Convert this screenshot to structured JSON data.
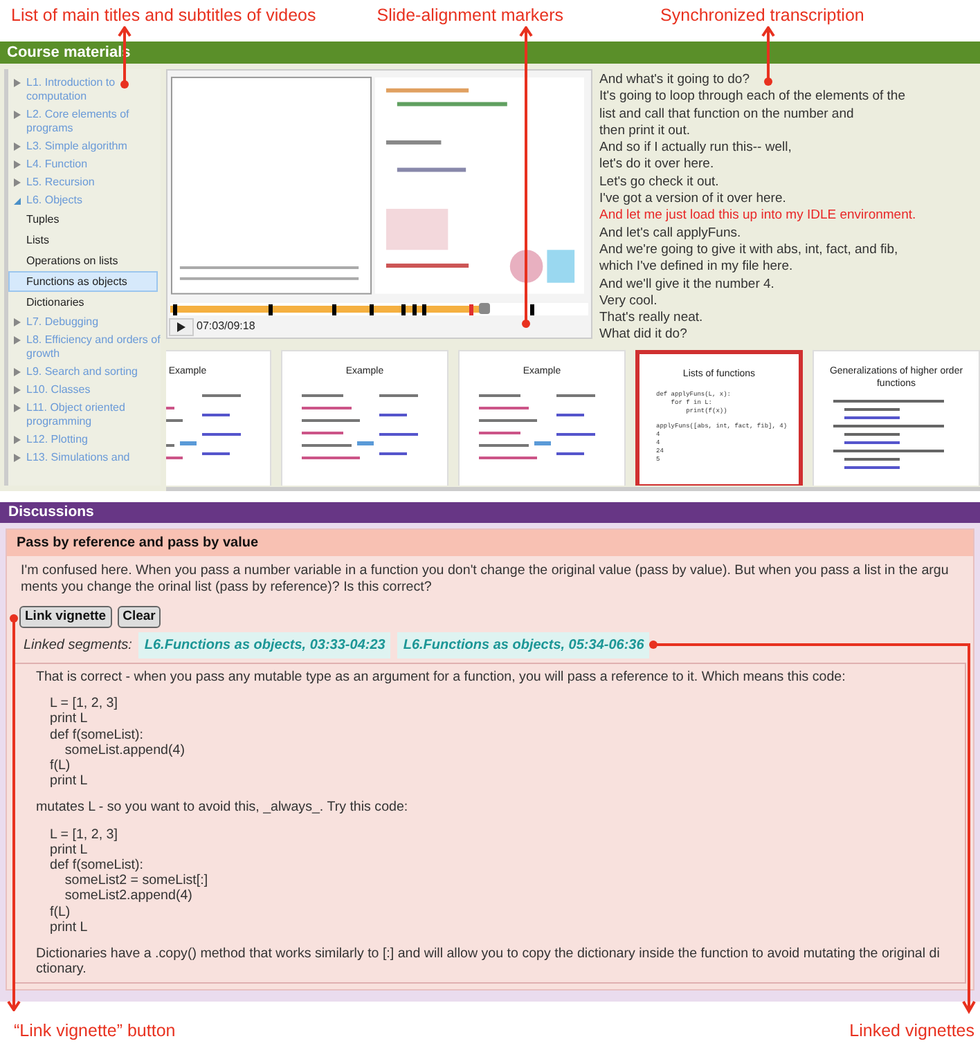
{
  "annotations_top": [
    "List of main titles and subtitles of videos",
    "Slide-alignment markers",
    "Synchronized transcription"
  ],
  "course_materials": {
    "title": "Course materials",
    "sidebar": [
      {
        "label": "L1. Introduction to computation",
        "expanded": false
      },
      {
        "label": "L2. Core elements of programs",
        "expanded": false
      },
      {
        "label": "L3. Simple algorithm",
        "expanded": false
      },
      {
        "label": "L4. Function",
        "expanded": false
      },
      {
        "label": "L5. Recursion",
        "expanded": false
      },
      {
        "label": "L6. Objects",
        "expanded": true,
        "children": [
          {
            "label": "Tuples",
            "selected": false
          },
          {
            "label": "Lists",
            "selected": false
          },
          {
            "label": "Operations on lists",
            "selected": false
          },
          {
            "label": "Functions as objects",
            "selected": true
          },
          {
            "label": "Dictionaries",
            "selected": false
          }
        ]
      },
      {
        "label": "L7. Debugging",
        "expanded": false
      },
      {
        "label": "L8. Efficiency and orders of growth",
        "expanded": false
      },
      {
        "label": "L9. Search and sorting",
        "expanded": false
      },
      {
        "label": "L10. Classes",
        "expanded": false
      },
      {
        "label": "L11. Object oriented programming",
        "expanded": false
      },
      {
        "label": "L12. Plotting",
        "expanded": false
      },
      {
        "label": "L13. Simulations and",
        "expanded": false
      }
    ],
    "player": {
      "level": 0.75,
      "time": "07:03/09:18",
      "markers": [
        {
          "level": 0.008,
          "selected": false
        },
        {
          "level": 0.236,
          "selected": false
        },
        {
          "level": 0.387,
          "selected": false
        },
        {
          "level": 0.478,
          "selected": false
        },
        {
          "level": 0.552,
          "selected": false
        },
        {
          "level": 0.58,
          "selected": false
        },
        {
          "level": 0.604,
          "selected": false
        },
        {
          "level": 0.716,
          "selected": true
        },
        {
          "level": 0.86,
          "selected": false
        }
      ]
    },
    "transcript": [
      {
        "text": "And what's it going to do?",
        "selected": false
      },
      {
        "text": "It's going to loop through each of the elements of the",
        "selected": false
      },
      {
        "text": "list and call that function on the number and",
        "selected": false
      },
      {
        "text": "then print it out.",
        "selected": false
      },
      {
        "text": "And so if I actually run this-- well,",
        "selected": false
      },
      {
        "text": "let's do it over here.",
        "selected": false
      },
      {
        "text": "Let's go check it out.",
        "selected": false
      },
      {
        "text": "I've got a version of it over here.",
        "selected": false
      },
      {
        "text": "And let me just load this up into my IDLE environment.",
        "selected": true
      },
      {
        "text": "And let's call applyFuns.",
        "selected": false
      },
      {
        "text": "And we're going to give it with abs, int, fact, and fib,",
        "selected": false
      },
      {
        "text": "which I've defined in my file here.",
        "selected": false
      },
      {
        "text": "And we'll give it the number 4.",
        "selected": false
      },
      {
        "text": "Very cool.",
        "selected": false
      },
      {
        "text": "That's really neat.",
        "selected": false
      },
      {
        "text": "What did it do?",
        "selected": false
      }
    ],
    "slides": [
      {
        "title": "Example",
        "kind": "code",
        "selected": false
      },
      {
        "title": "Example",
        "kind": "code",
        "selected": false
      },
      {
        "title": "Example",
        "kind": "code",
        "selected": false
      },
      {
        "title": "Lists of functions",
        "kind": "listing",
        "selected": true,
        "lines": [
          "def applyFuns(L, x):",
          "    for f in L:",
          "        print(f(x))"
        ],
        "call_lines": [
          "applyFuns([abs, int, fact, fib], 4)",
          "4",
          "4",
          "24",
          "5"
        ]
      },
      {
        "title": "Generalizations of higher order functions",
        "kind": "bullets",
        "selected": false
      }
    ]
  },
  "discussions": {
    "title": "Discussions",
    "thread": {
      "title": "Pass by reference and pass by value",
      "question": "I'm confused here. When you pass a number variable in a function you don't change the original value (pass by value). But when you pass a list in the arguments you change the orinal list (pass by reference)? Is this correct?",
      "buttons": [
        "Link vignette",
        "Clear"
      ],
      "linked_label": "Linked segments:",
      "linked_segments": [
        "L6.Functions as objects, 03:33-04:23",
        "L6.Functions as objects, 05:34-06:36"
      ],
      "answer": [
        {
          "kind": "text",
          "text": "That is correct - when you pass any mutable type as an argument for a function, you will pass a reference to it. Which means this code:"
        },
        {
          "kind": "code",
          "lines": [
            "L = [1, 2, 3]",
            "print L",
            "def f(someList):",
            "    someList.append(4)",
            "f(L)",
            "print L"
          ]
        },
        {
          "kind": "text",
          "text": "mutates L - so you want to avoid this, _always_. Try this code:"
        },
        {
          "kind": "code",
          "lines": [
            "L = [1, 2, 3]",
            "print L",
            "def f(someList):",
            "    someList2 = someList[:]",
            "    someList2.append(4)",
            "f(L)",
            "print L"
          ]
        },
        {
          "kind": "text",
          "text": "Dictionaries have a .copy() method that works similarly to [:] and will allow you to copy the dictionary inside the function to avoid mutating the original dictionary."
        }
      ]
    }
  },
  "annotations_bottom": [
    "“Link vignette” button",
    "Linked vignettes"
  ]
}
